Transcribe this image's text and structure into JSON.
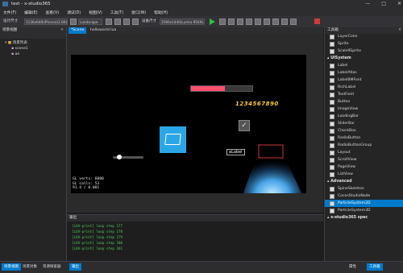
{
  "window": {
    "title": "test - x-studio365"
  },
  "menu": [
    "文件(F)",
    "编辑(E)",
    "查看(V)",
    "调试(D)",
    "视图(V)",
    "工具(T)",
    "窗口(W)",
    "帮助(H)"
  ],
  "toolbar": {
    "design_size_label": "设计尺寸",
    "design_size_value": "1136x640(iPhone)(2.66)",
    "orientation_value": "Landscape",
    "device_label": "设备尺寸",
    "device_value": "2560x1440(Lumia 950XL)"
  },
  "left_panel": {
    "title": "场景视图",
    "root": "场景列表",
    "items": [
      "scene1",
      "ae"
    ]
  },
  "tabs": [
    "*Scene",
    "helloworld.lua"
  ],
  "game": {
    "number_label": "1234567890",
    "label_text": "aLabel",
    "progress": 0.55,
    "slider": 0.2,
    "stats": [
      "GL verts:  6080",
      "GL calls:    53",
      "91.4 / 0.001"
    ]
  },
  "output": {
    "title": "输出",
    "lines": [
      "[LUA-print] loop step 177",
      "[LUA-print] loop step 178",
      "[LUA-print] loop step 179",
      "[LUA-print] loop step 180",
      "[LUA-print] loop step 181"
    ]
  },
  "right_panel": {
    "title": "工具箱",
    "top_items": [
      "LayerColor",
      "Sprite",
      "Scale9Sprite"
    ],
    "ui_section": "UISystem",
    "ui_items": [
      "Label",
      "LabelAtlas",
      "LabelBMFont",
      "RichLabel",
      "TextField",
      "Button",
      "ImageView",
      "LoadingBar",
      "SliderBar",
      "CheckBox",
      "RadioButton",
      "RadioButtonGroup",
      "Layout",
      "ScrollView",
      "PageView",
      "ListView"
    ],
    "adv_section": "Advanced",
    "adv_items": [
      "SpineSkeleton",
      "CocosStudioNode",
      "ParticleSystem2D",
      "ParticleSystem3D"
    ],
    "selected": "ParticleSystem2D",
    "bottom_section": "x-studio365 spec"
  },
  "status": {
    "left_tabs": [
      "场景视图",
      "场景对象",
      "资源探索器"
    ],
    "out_tab": "输出",
    "right_tabs": [
      "属性",
      "工具箱"
    ]
  }
}
